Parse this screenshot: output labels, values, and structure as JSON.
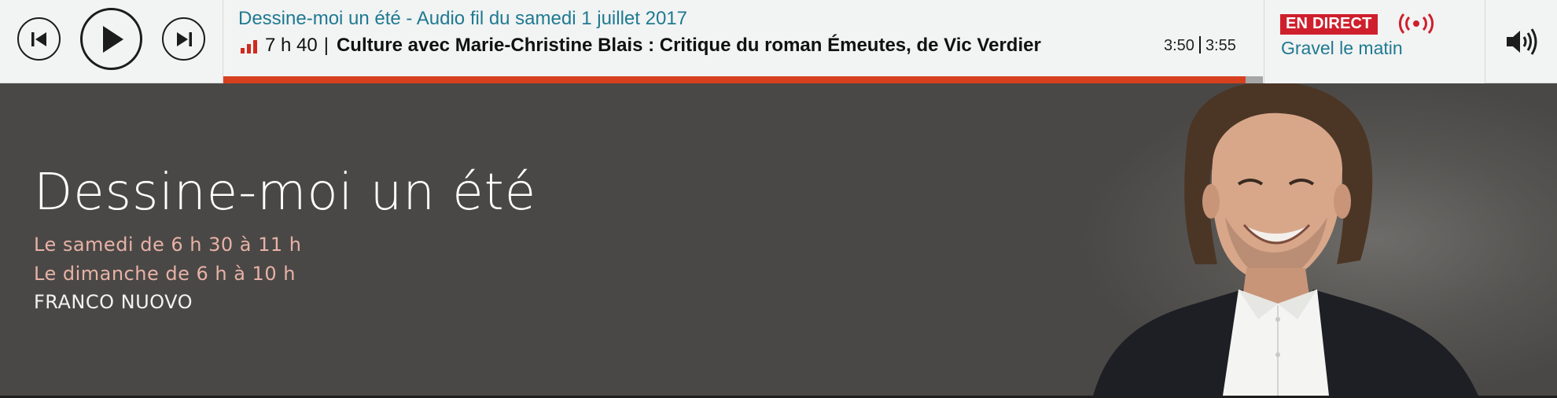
{
  "player": {
    "controls": {
      "previous_icon": "skip-previous-icon",
      "play_icon": "play-icon",
      "next_icon": "skip-next-icon"
    },
    "now_playing": {
      "show_title": "Dessine-moi un été - Audio fil du samedi 1 juillet 2017",
      "segment_time": "7 h 40",
      "separator": "|",
      "segment_title": "Culture avec Marie-Christine Blais : Critique du roman Émeutes, de Vic Verdier",
      "elapsed": "3:50",
      "duration": "3:55",
      "progress": 0.983
    },
    "live": {
      "badge": "EN DIRECT",
      "icon": "broadcast-icon",
      "show": "Gravel le matin"
    },
    "volume_icon": "volume-icon"
  },
  "hero": {
    "title": "Dessine-moi un été",
    "schedule": [
      "Le samedi de 6 h 30 à 11 h",
      "Le dimanche de 6 h à 10 h"
    ],
    "host": "FRANCO NUOVO"
  },
  "colors": {
    "accent_blue": "#1f7a91",
    "live_red": "#cf1f2c",
    "progress_orange": "#d6401e",
    "hero_bg": "#4a4846",
    "schedule_pink": "#e7b2a6"
  }
}
